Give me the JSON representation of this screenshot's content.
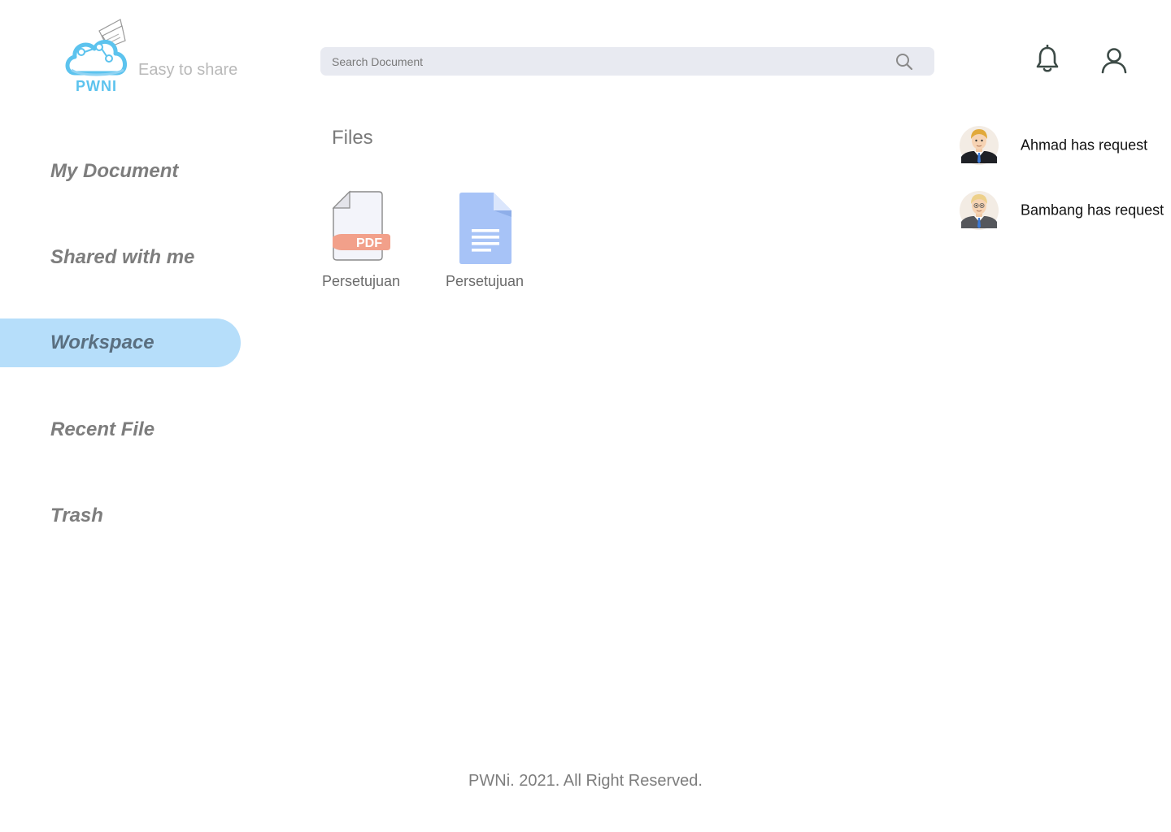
{
  "brand": {
    "logo_icon": "cloud-share-logo-icon",
    "name": "PWNI",
    "tagline": "Easy to share",
    "accent_color": "#5cc3ee"
  },
  "search": {
    "placeholder": "Search Document",
    "value": "",
    "icon": "search-icon"
  },
  "header": {
    "notification_icon": "bell-icon",
    "profile_icon": "user-icon"
  },
  "sidebar": {
    "items": [
      {
        "label": "My Document",
        "active": false
      },
      {
        "label": "Shared with me",
        "active": false
      },
      {
        "label": "Workspace",
        "active": true
      },
      {
        "label": "Recent File",
        "active": false
      },
      {
        "label": "Trash",
        "active": false
      }
    ],
    "active_color": "#b6defa"
  },
  "main": {
    "section_title": "Files",
    "files": [
      {
        "name": "Persetujuan",
        "type": "pdf",
        "icon": "pdf-file-icon",
        "badge": "PDF"
      },
      {
        "name": "Persetujuan",
        "type": "doc",
        "icon": "document-file-icon"
      }
    ]
  },
  "notifications": [
    {
      "text": "Ahmad has request",
      "avatar": "avatar-ahmad"
    },
    {
      "text": "Bambang has request",
      "avatar": "avatar-bambang"
    }
  ],
  "footer": {
    "text": "PWNi. 2021. All Right Reserved."
  }
}
